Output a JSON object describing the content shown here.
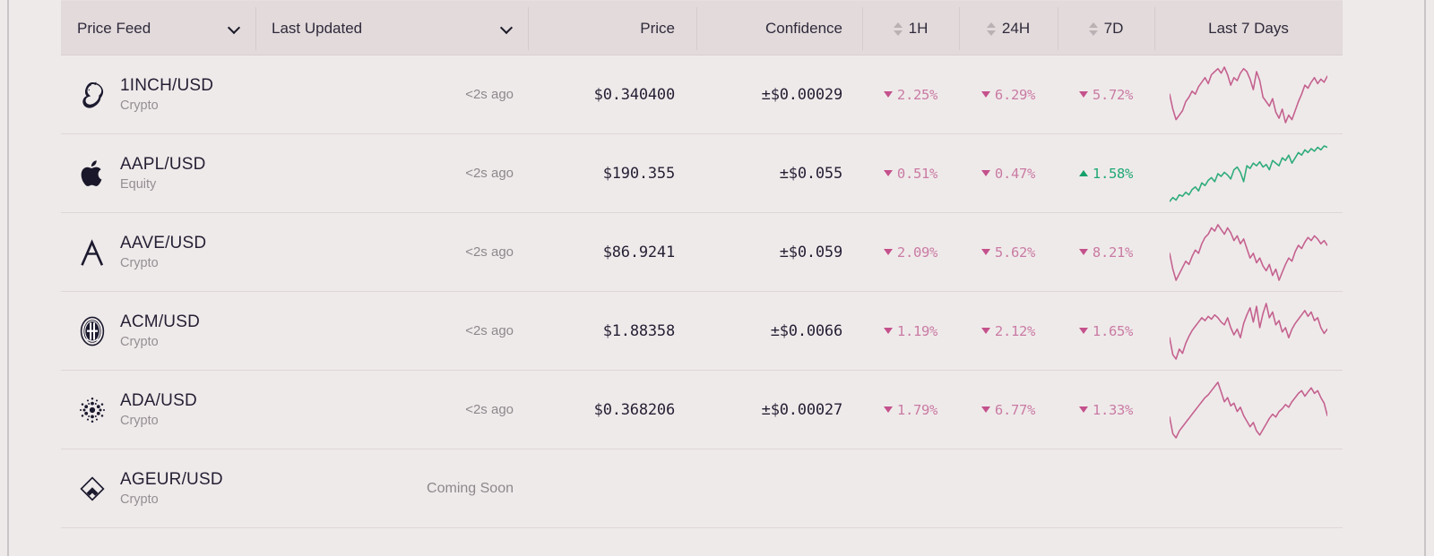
{
  "header": {
    "columns": [
      {
        "label": "Price Feed",
        "icon": "chevron-down-icon",
        "name": "price-feed"
      },
      {
        "label": "Last Updated",
        "icon": "chevron-down-icon",
        "name": "last-updated"
      },
      {
        "label": "Price",
        "icon": "",
        "name": "price"
      },
      {
        "label": "Confidence",
        "icon": "",
        "name": "confidence"
      },
      {
        "label": "1H",
        "icon": "sort-icon",
        "name": "1h"
      },
      {
        "label": "24H",
        "icon": "sort-icon",
        "name": "24h"
      },
      {
        "label": "7D",
        "icon": "sort-icon",
        "name": "7d"
      },
      {
        "label": "Last 7 Days",
        "icon": "",
        "name": "last-7-days"
      }
    ]
  },
  "colors": {
    "page_background": "#efeaea",
    "header_background": "#e2dadb",
    "negative": "#c97ba3",
    "positive": "#1fa874",
    "spark_negative": "#c4628f",
    "spark_positive": "#2fac7c",
    "text_primary": "#241f33",
    "text_muted": "#8d878c"
  },
  "rows": [
    {
      "icon": "unicorn-1inch-icon",
      "symbol": "1INCH/USD",
      "asset": "Crypto",
      "updated": "<2s ago",
      "price": "$0.340400",
      "confidence": "±$0.00029",
      "h1": {
        "value": "2.25%",
        "dir": "down"
      },
      "h24": {
        "value": "6.29%",
        "dir": "down"
      },
      "d7": {
        "value": "5.72%",
        "dir": "down"
      },
      "spark_trend": "down",
      "coming_soon": false
    },
    {
      "icon": "apple-icon",
      "symbol": "AAPL/USD",
      "asset": "Equity",
      "updated": "<2s ago",
      "price": "$190.355",
      "confidence": "±$0.055",
      "h1": {
        "value": "0.51%",
        "dir": "down"
      },
      "h24": {
        "value": "0.47%",
        "dir": "down"
      },
      "d7": {
        "value": "1.58%",
        "dir": "up"
      },
      "spark_trend": "up",
      "coming_soon": false
    },
    {
      "icon": "aave-icon",
      "symbol": "AAVE/USD",
      "asset": "Crypto",
      "updated": "<2s ago",
      "price": "$86.9241",
      "confidence": "±$0.059",
      "h1": {
        "value": "2.09%",
        "dir": "down"
      },
      "h24": {
        "value": "5.62%",
        "dir": "down"
      },
      "d7": {
        "value": "8.21%",
        "dir": "down"
      },
      "spark_trend": "down",
      "coming_soon": false
    },
    {
      "icon": "ac-milan-icon",
      "symbol": "ACM/USD",
      "asset": "Crypto",
      "updated": "<2s ago",
      "price": "$1.88358",
      "confidence": "±$0.0066",
      "h1": {
        "value": "1.19%",
        "dir": "down"
      },
      "h24": {
        "value": "2.12%",
        "dir": "down"
      },
      "d7": {
        "value": "1.65%",
        "dir": "down"
      },
      "spark_trend": "down",
      "coming_soon": false
    },
    {
      "icon": "cardano-icon",
      "symbol": "ADA/USD",
      "asset": "Crypto",
      "updated": "<2s ago",
      "price": "$0.368206",
      "confidence": "±$0.00027",
      "h1": {
        "value": "1.79%",
        "dir": "down"
      },
      "h24": {
        "value": "6.77%",
        "dir": "down"
      },
      "d7": {
        "value": "1.33%",
        "dir": "down"
      },
      "spark_trend": "down",
      "coming_soon": false
    },
    {
      "icon": "angle-ageur-icon",
      "symbol": "AGEUR/USD",
      "asset": "Crypto",
      "updated": "Coming Soon",
      "price": "",
      "confidence": "",
      "h1": {
        "value": "",
        "dir": ""
      },
      "h24": {
        "value": "",
        "dir": ""
      },
      "d7": {
        "value": "",
        "dir": ""
      },
      "spark_trend": "",
      "coming_soon": true
    }
  ],
  "chart_data": {
    "type": "line",
    "title": "Last 7 Days",
    "note": "Sparkline price history per feed, 7 day window",
    "series": [
      {
        "name": "1INCH/USD",
        "trend": "down",
        "values": [
          52,
          72,
          86,
          80,
          74,
          62,
          56,
          48,
          52,
          42,
          36,
          30,
          38,
          26,
          22,
          18,
          24,
          16,
          26,
          40,
          30,
          34,
          24,
          18,
          22,
          32,
          46,
          22,
          34,
          56,
          62,
          68,
          58,
          76,
          84,
          72,
          90,
          80,
          86,
          74,
          62,
          52,
          40,
          44,
          36,
          30,
          38,
          32,
          36,
          28
        ]
      },
      {
        "name": "AAPL/USD",
        "trend": "up",
        "values": [
          88,
          82,
          86,
          78,
          80,
          74,
          78,
          70,
          66,
          72,
          60,
          64,
          56,
          52,
          58,
          46,
          50,
          44,
          48,
          54,
          40,
          36,
          44,
          58,
          34,
          38,
          30,
          34,
          28,
          36,
          32,
          40,
          26,
          30,
          34,
          22,
          26,
          18,
          30,
          22,
          14,
          18,
          10,
          14,
          8,
          12,
          6,
          10,
          4,
          6
        ]
      },
      {
        "name": "AAVE/USD",
        "trend": "down",
        "values": [
          50,
          70,
          84,
          76,
          68,
          60,
          64,
          54,
          46,
          50,
          38,
          30,
          26,
          18,
          22,
          14,
          20,
          26,
          18,
          24,
          34,
          28,
          38,
          32,
          44,
          56,
          50,
          62,
          56,
          66,
          72,
          64,
          78,
          70,
          84,
          74,
          64,
          56,
          60,
          48,
          40,
          44,
          36,
          30,
          34,
          28,
          32,
          38,
          34,
          40
        ]
      },
      {
        "name": "ACM/USD",
        "trend": "down",
        "values": [
          58,
          82,
          88,
          74,
          80,
          66,
          56,
          48,
          42,
          36,
          30,
          34,
          28,
          32,
          26,
          30,
          36,
          40,
          30,
          44,
          54,
          46,
          58,
          38,
          26,
          16,
          36,
          14,
          44,
          24,
          10,
          30,
          22,
          40,
          34,
          50,
          44,
          58,
          46,
          38,
          32,
          26,
          20,
          28,
          22,
          34,
          30,
          44,
          52,
          46
        ]
      },
      {
        "name": "ADA/USD",
        "trend": "down",
        "values": [
          56,
          80,
          86,
          76,
          70,
          64,
          58,
          52,
          46,
          40,
          34,
          28,
          24,
          18,
          12,
          6,
          20,
          34,
          28,
          40,
          36,
          48,
          42,
          54,
          62,
          70,
          64,
          76,
          82,
          74,
          66,
          58,
          52,
          56,
          48,
          44,
          38,
          42,
          34,
          28,
          22,
          18,
          26,
          20,
          14,
          22,
          18,
          28,
          36,
          54
        ]
      }
    ]
  }
}
